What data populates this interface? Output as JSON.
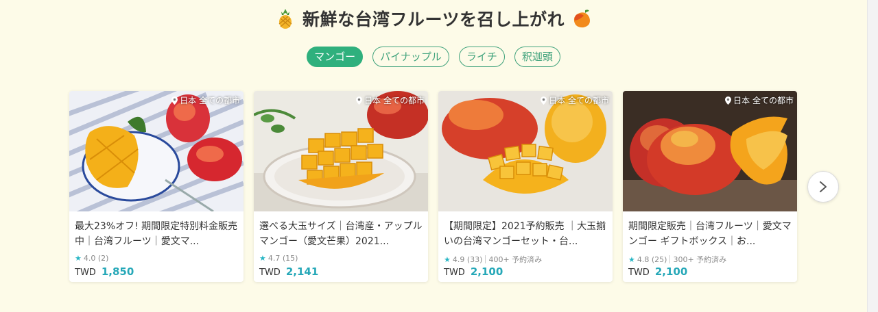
{
  "heading": {
    "title": "新鮮な台湾フルーツを召し上がれ",
    "left_icon": "pineapple-icon",
    "right_icon": "mango-icon"
  },
  "tabs": [
    {
      "label": "マンゴー",
      "active": true
    },
    {
      "label": "パイナップル",
      "active": false
    },
    {
      "label": "ライチ",
      "active": false
    },
    {
      "label": "釈迦頭",
      "active": false
    }
  ],
  "cards": [
    {
      "location": "日本 全ての都市",
      "title": "最大23%オフ! 期間限定特別料金販売中｜台湾フルーツ｜愛文マ...",
      "rating": "4.0",
      "reviews": "(2)",
      "booked": "",
      "currency": "TWD",
      "price": "1,850"
    },
    {
      "location": "日本 全ての都市",
      "title": "選べる大玉サイズ｜台湾産・アップルマンゴー（愛文芒果）2021...",
      "rating": "4.7",
      "reviews": "(15)",
      "booked": "",
      "currency": "TWD",
      "price": "2,141"
    },
    {
      "location": "日本 全ての都市",
      "title": "【期間限定】2021予約販売 ｜大玉揃いの台湾マンゴーセット・台...",
      "rating": "4.9",
      "reviews": "(33)",
      "booked": "400+ 予約済み",
      "currency": "TWD",
      "price": "2,100"
    },
    {
      "location": "日本 全ての都市",
      "title": "期間限定販売｜台湾フルーツ｜愛文マンゴー ギフトボックス｜お...",
      "rating": "4.8",
      "reviews": "(25)",
      "booked": "300+ 予約済み",
      "currency": "TWD",
      "price": "2,100"
    }
  ],
  "colors": {
    "background": "#fdfbe8",
    "accent_green": "#2fb07d",
    "price_teal": "#26a8b8"
  },
  "next_button_icon": "chevron-right-icon"
}
